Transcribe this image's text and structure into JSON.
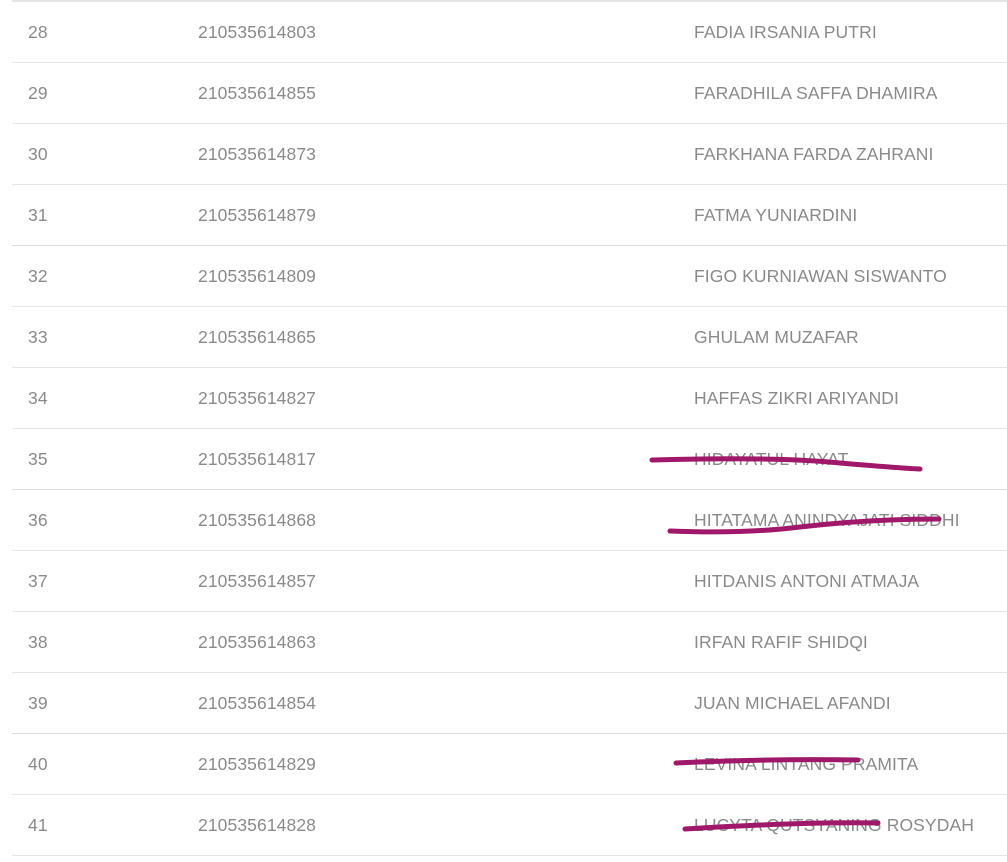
{
  "table": {
    "rows": [
      {
        "no": "28",
        "nim": "210535614803",
        "name": "FADIA IRSANIA PUTRI"
      },
      {
        "no": "29",
        "nim": "210535614855",
        "name": "FARADHILA SAFFA DHAMIRA"
      },
      {
        "no": "30",
        "nim": "210535614873",
        "name": "FARKHANA FARDA ZAHRANI"
      },
      {
        "no": "31",
        "nim": "210535614879",
        "name": "FATMA YUNIARDINI"
      },
      {
        "no": "32",
        "nim": "210535614809",
        "name": "FIGO KURNIAWAN SISWANTO"
      },
      {
        "no": "33",
        "nim": "210535614865",
        "name": "GHULAM MUZAFAR"
      },
      {
        "no": "34",
        "nim": "210535614827",
        "name": "HAFFAS ZIKRI ARIYANDI"
      },
      {
        "no": "35",
        "nim": "210535614817",
        "name": "HIDAYATUL HAYAT"
      },
      {
        "no": "36",
        "nim": "210535614868",
        "name": "HITATAMA ANINDYAJATI SIDDHI"
      },
      {
        "no": "37",
        "nim": "210535614857",
        "name": "HITDANIS ANTONI ATMAJA"
      },
      {
        "no": "38",
        "nim": "210535614863",
        "name": "IRFAN RAFIF SHIDQI"
      },
      {
        "no": "39",
        "nim": "210535614854",
        "name": "JUAN MICHAEL AFANDI"
      },
      {
        "no": "40",
        "nim": "210535614829",
        "name": "LEVINA LINTANG PRAMITA"
      },
      {
        "no": "41",
        "nim": "210535614828",
        "name": "LUCYTA QUTSYANING ROSYDAH"
      }
    ]
  },
  "annotations": {
    "strike_color": "#a0186a"
  }
}
